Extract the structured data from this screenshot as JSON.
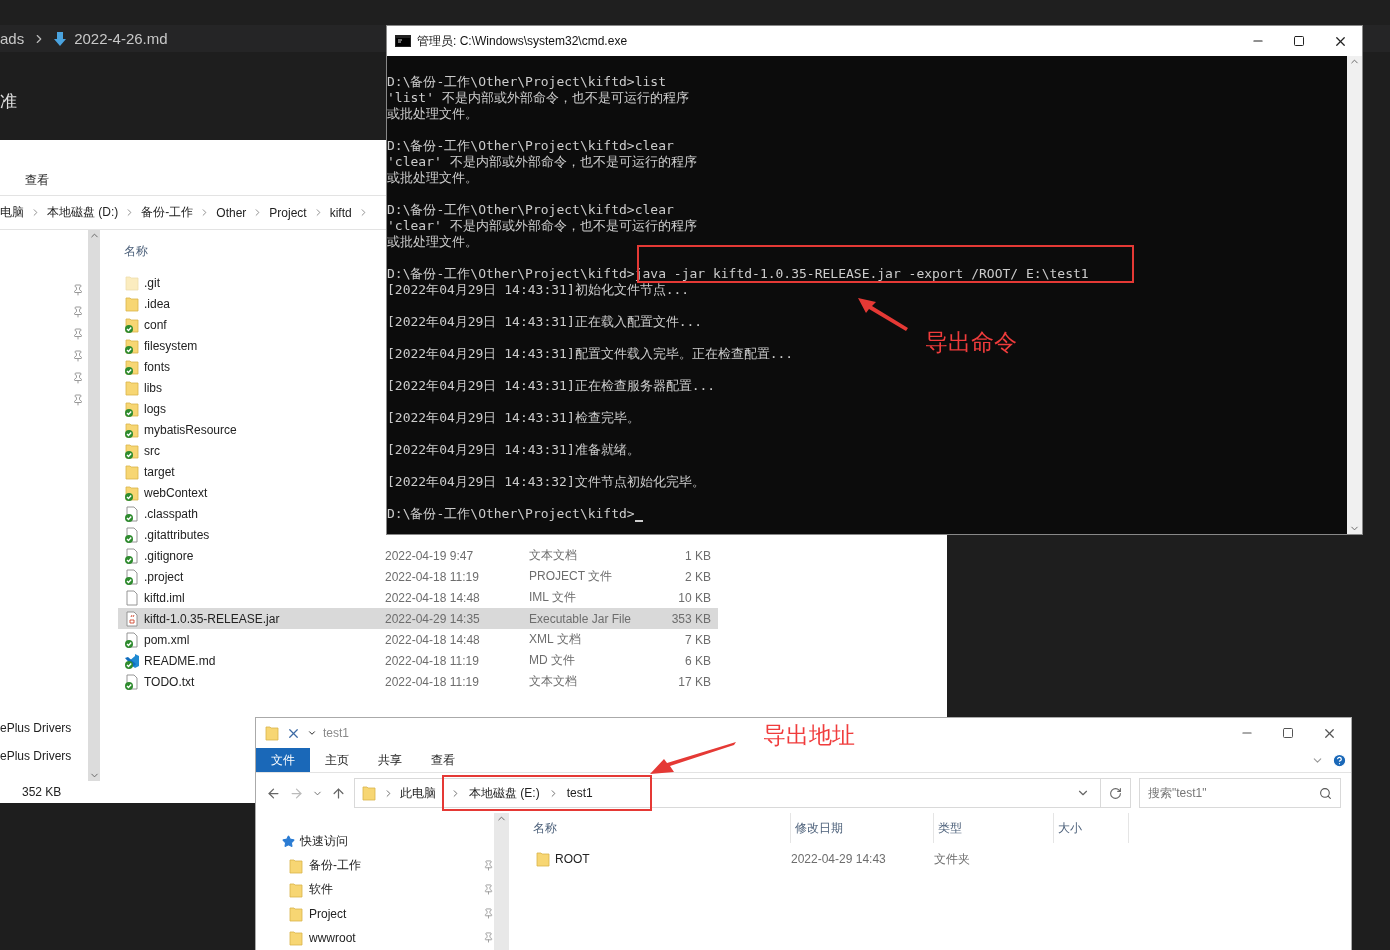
{
  "editor": {
    "breadcrumb": [
      "ads",
      "2022-4-26.md"
    ],
    "heading": "准"
  },
  "explorer_back": {
    "ribbon_tab": "查看",
    "path": [
      "电脑",
      "本地磁盘 (D:)",
      "备份-工作",
      "Other",
      "Project",
      "kiftd"
    ],
    "column_header": "名称",
    "nav_items": [
      "ePlus Drivers",
      "ePlus Drivers"
    ],
    "status": "352 KB",
    "files": [
      {
        "name": ".git",
        "kind": "folder-hidden",
        "selected": false
      },
      {
        "name": ".idea",
        "kind": "folder",
        "selected": false
      },
      {
        "name": "conf",
        "kind": "folder-ok",
        "selected": false
      },
      {
        "name": "filesystem",
        "kind": "folder-ok",
        "selected": false
      },
      {
        "name": "fonts",
        "kind": "folder-ok",
        "selected": false
      },
      {
        "name": "libs",
        "kind": "folder",
        "selected": false
      },
      {
        "name": "logs",
        "kind": "folder-ok",
        "selected": false
      },
      {
        "name": "mybatisResource",
        "kind": "folder-ok",
        "selected": false
      },
      {
        "name": "src",
        "kind": "folder-ok",
        "selected": false
      },
      {
        "name": "target",
        "kind": "folder",
        "selected": false
      },
      {
        "name": "webContext",
        "kind": "folder-ok",
        "selected": false
      },
      {
        "name": ".classpath",
        "kind": "file-ok",
        "selected": false
      },
      {
        "name": ".gitattributes",
        "kind": "file-ok",
        "selected": false
      },
      {
        "name": ".gitignore",
        "kind": "file-ok",
        "date": "2022-04-19 9:47",
        "type": "文本文档",
        "size": "1 KB",
        "selected": false
      },
      {
        "name": ".project",
        "kind": "file-ok",
        "date": "2022-04-18 11:19",
        "type": "PROJECT 文件",
        "size": "2 KB",
        "selected": false
      },
      {
        "name": "kiftd.iml",
        "kind": "file",
        "date": "2022-04-18 14:48",
        "type": "IML 文件",
        "size": "10 KB",
        "selected": false
      },
      {
        "name": "kiftd-1.0.35-RELEASE.jar",
        "kind": "jar",
        "date": "2022-04-29 14:35",
        "type": "Executable Jar File",
        "size": "353 KB",
        "selected": true
      },
      {
        "name": "pom.xml",
        "kind": "file-ok",
        "date": "2022-04-18 14:48",
        "type": "XML 文档",
        "size": "7 KB",
        "selected": false
      },
      {
        "name": "README.md",
        "kind": "md",
        "date": "2022-04-18 11:19",
        "type": "MD 文件",
        "size": "6 KB",
        "selected": false
      },
      {
        "name": "TODO.txt",
        "kind": "file-ok",
        "date": "2022-04-18 11:19",
        "type": "文本文档",
        "size": "17 KB",
        "selected": false
      }
    ]
  },
  "cmd": {
    "title": "管理员: C:\\Windows\\system32\\cmd.exe",
    "blocks": [
      {
        "lines": [
          "D:\\备份-工作\\Other\\Project\\kiftd>list",
          "'list' 不是内部或外部命令，也不是可运行的程序",
          "或批处理文件。"
        ]
      },
      {
        "lines": [
          "D:\\备份-工作\\Other\\Project\\kiftd>clear",
          "'clear' 不是内部或外部命令，也不是可运行的程序",
          "或批处理文件。"
        ]
      },
      {
        "lines": [
          "D:\\备份-工作\\Other\\Project\\kiftd>clear",
          "'clear' 不是内部或外部命令，也不是可运行的程序",
          "或批处理文件。"
        ]
      },
      {
        "lines": [
          "D:\\备份-工作\\Other\\Project\\kiftd>java -jar kiftd-1.0.35-RELEASE.jar -export /ROOT/ E:\\test1",
          "[2022年04月29日 14:43:31]初始化文件节点..."
        ]
      },
      {
        "lines": [
          "[2022年04月29日 14:43:31]正在载入配置文件..."
        ]
      },
      {
        "lines": [
          "[2022年04月29日 14:43:31]配置文件载入完毕。正在检查配置..."
        ]
      },
      {
        "lines": [
          "[2022年04月29日 14:43:31]正在检查服务器配置..."
        ]
      },
      {
        "lines": [
          "[2022年04月29日 14:43:31]检查完毕。"
        ]
      },
      {
        "lines": [
          "[2022年04月29日 14:43:31]准备就绪。"
        ]
      },
      {
        "lines": [
          "[2022年04月29日 14:43:32]文件节点初始化完毕。"
        ]
      },
      {
        "lines": [
          "D:\\备份-工作\\Other\\Project\\kiftd>"
        ]
      }
    ],
    "annotation": "导出命令"
  },
  "explorer_front": {
    "title": "test1",
    "tabs": [
      {
        "label": "文件",
        "selected": true
      },
      {
        "label": "主页",
        "selected": false
      },
      {
        "label": "共享",
        "selected": false
      },
      {
        "label": "查看",
        "selected": false
      }
    ],
    "path": [
      {
        "label": "此电脑",
        "highlighted": false
      },
      {
        "label": "本地磁盘 (E:)",
        "highlighted": true
      },
      {
        "label": "test1",
        "highlighted": true
      }
    ],
    "search": {
      "placeholder": "搜索\"test1\""
    },
    "nav_header": "快速访问",
    "nav_items": [
      "备份-工作",
      "软件",
      "Project",
      "wwwroot"
    ],
    "columns": [
      "名称",
      "修改日期",
      "类型",
      "大小"
    ],
    "rows": [
      {
        "name": "ROOT",
        "date": "2022-04-29 14:43",
        "type": "文件夹"
      }
    ],
    "annotation": "导出地址"
  }
}
